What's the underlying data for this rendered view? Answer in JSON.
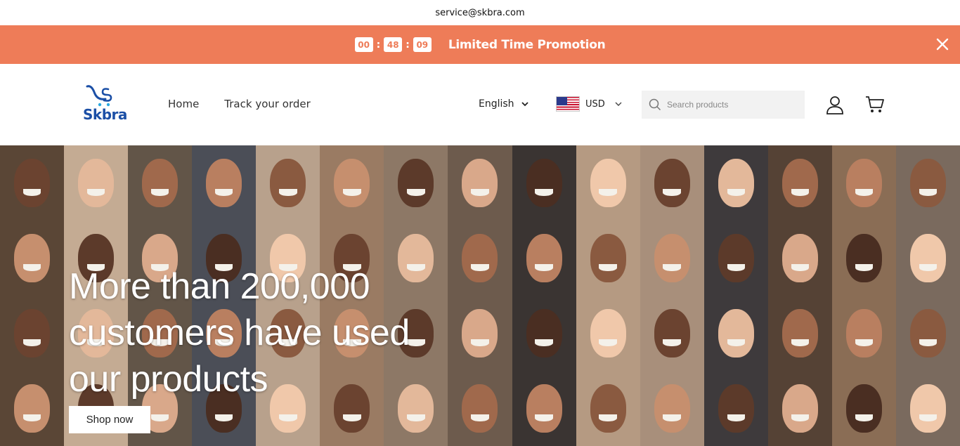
{
  "topbar": {
    "email": "service@skbra.com"
  },
  "promo": {
    "countdown": {
      "hours": "00",
      "minutes": "48",
      "seconds": "09",
      "separator": ":"
    },
    "text": "Limited Time Promotion",
    "bg_color": "#ee7c58"
  },
  "header": {
    "logo_text": "Skbra",
    "nav": [
      {
        "label": "Home"
      },
      {
        "label": "Track your order"
      }
    ],
    "language": "English",
    "currency": "USD",
    "search": {
      "placeholder": "Search products"
    }
  },
  "hero": {
    "title": "More than 200,000 customers have used our products",
    "button_label": "Shop now"
  }
}
